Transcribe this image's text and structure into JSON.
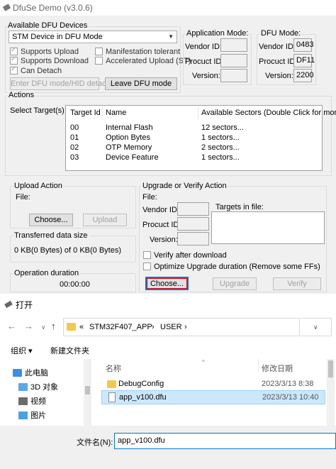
{
  "dfuse": {
    "title": "DfuSe Demo (v3.0.6)",
    "devices_group": "Available DFU Devices",
    "device_selected": "STM Device in DFU Mode",
    "checks": [
      {
        "label": "Supports Upload",
        "checked": true
      },
      {
        "label": "Supports Download",
        "checked": true
      },
      {
        "label": "Can Detach",
        "checked": true
      },
      {
        "label": "Manifestation tolerant",
        "checked": false
      },
      {
        "label": "Accelerated Upload (ST)",
        "checked": false
      }
    ],
    "enter_dfu_button": "Enter DFU mode/HID detach",
    "leave_dfu_button": "Leave DFU mode",
    "app_mode": {
      "legend": "Application Mode:",
      "vendor_label": "Vendor ID:",
      "product_label": "Procuct ID:",
      "version_label": "Version:",
      "vendor": "",
      "product": "",
      "version": ""
    },
    "dfu_mode": {
      "legend": "DFU Mode:",
      "vendor_label": "Vendor ID:",
      "product_label": "Procuct ID:",
      "version_label": "Version:",
      "vendor": "0483",
      "product": "DF11",
      "version": "2200"
    },
    "actions_group": "Actions",
    "select_targets_label": "Select Target(s):",
    "targets_table": {
      "columns": [
        "Target Id",
        "Name",
        "Available Sectors (Double Click for more)"
      ],
      "rows": [
        [
          "00",
          "Internal Flash",
          "12 sectors..."
        ],
        [
          "01",
          "Option Bytes",
          "1 sectors..."
        ],
        [
          "02",
          "OTP Memory",
          "2 sectors..."
        ],
        [
          "03",
          "Device Feature",
          "1 sectors..."
        ]
      ]
    },
    "upload_action": {
      "legend": "Upload Action",
      "file_label": "File:",
      "choose_button": "Choose...",
      "upload_button": "Upload"
    },
    "transferred": {
      "legend": "Transferred data size",
      "value": "0 KB(0 Bytes) of 0 KB(0 Bytes)"
    },
    "operation_duration": {
      "legend": "Operation duration",
      "value": "00:00:00"
    },
    "upgrade_verify": {
      "legend": "Upgrade or Verify Action",
      "file_label": "File:",
      "vendor_label": "Vendor ID:",
      "product_label": "Procuct ID:",
      "version_label": "Version:",
      "targets_in_file_label": "Targets in file:",
      "verify_after_download": "Verify after download",
      "optimize_upgrade": "Optimize Upgrade duration (Remove some FFs)",
      "choose_button": "Choose...",
      "upgrade_button": "Upgrade",
      "verify_button": "Verify"
    }
  },
  "dialog": {
    "title": "打开",
    "breadcrumb": [
      "«",
      "STM32F407_APP",
      "›",
      "USER"
    ],
    "organize_label": "组织 ▾",
    "new_folder_label": "新建文件夹",
    "tree": [
      {
        "label": "此电脑",
        "icon": "computer-icon"
      },
      {
        "label": "3D 对象",
        "icon": "3d-objects-icon"
      },
      {
        "label": "视频",
        "icon": "video-icon"
      },
      {
        "label": "图片",
        "icon": "pictures-icon"
      }
    ],
    "columns": {
      "name": "名称",
      "modified": "修改日期"
    },
    "files": [
      {
        "name": "DebugConfig",
        "date": "2023/3/13 8:38",
        "type": "folder",
        "selected": false
      },
      {
        "name": "app_v100.dfu",
        "date": "2023/3/13 10:40",
        "type": "file",
        "selected": true
      }
    ],
    "filename_label": "文件名(N):",
    "filename_value": "app_v100.dfu"
  }
}
